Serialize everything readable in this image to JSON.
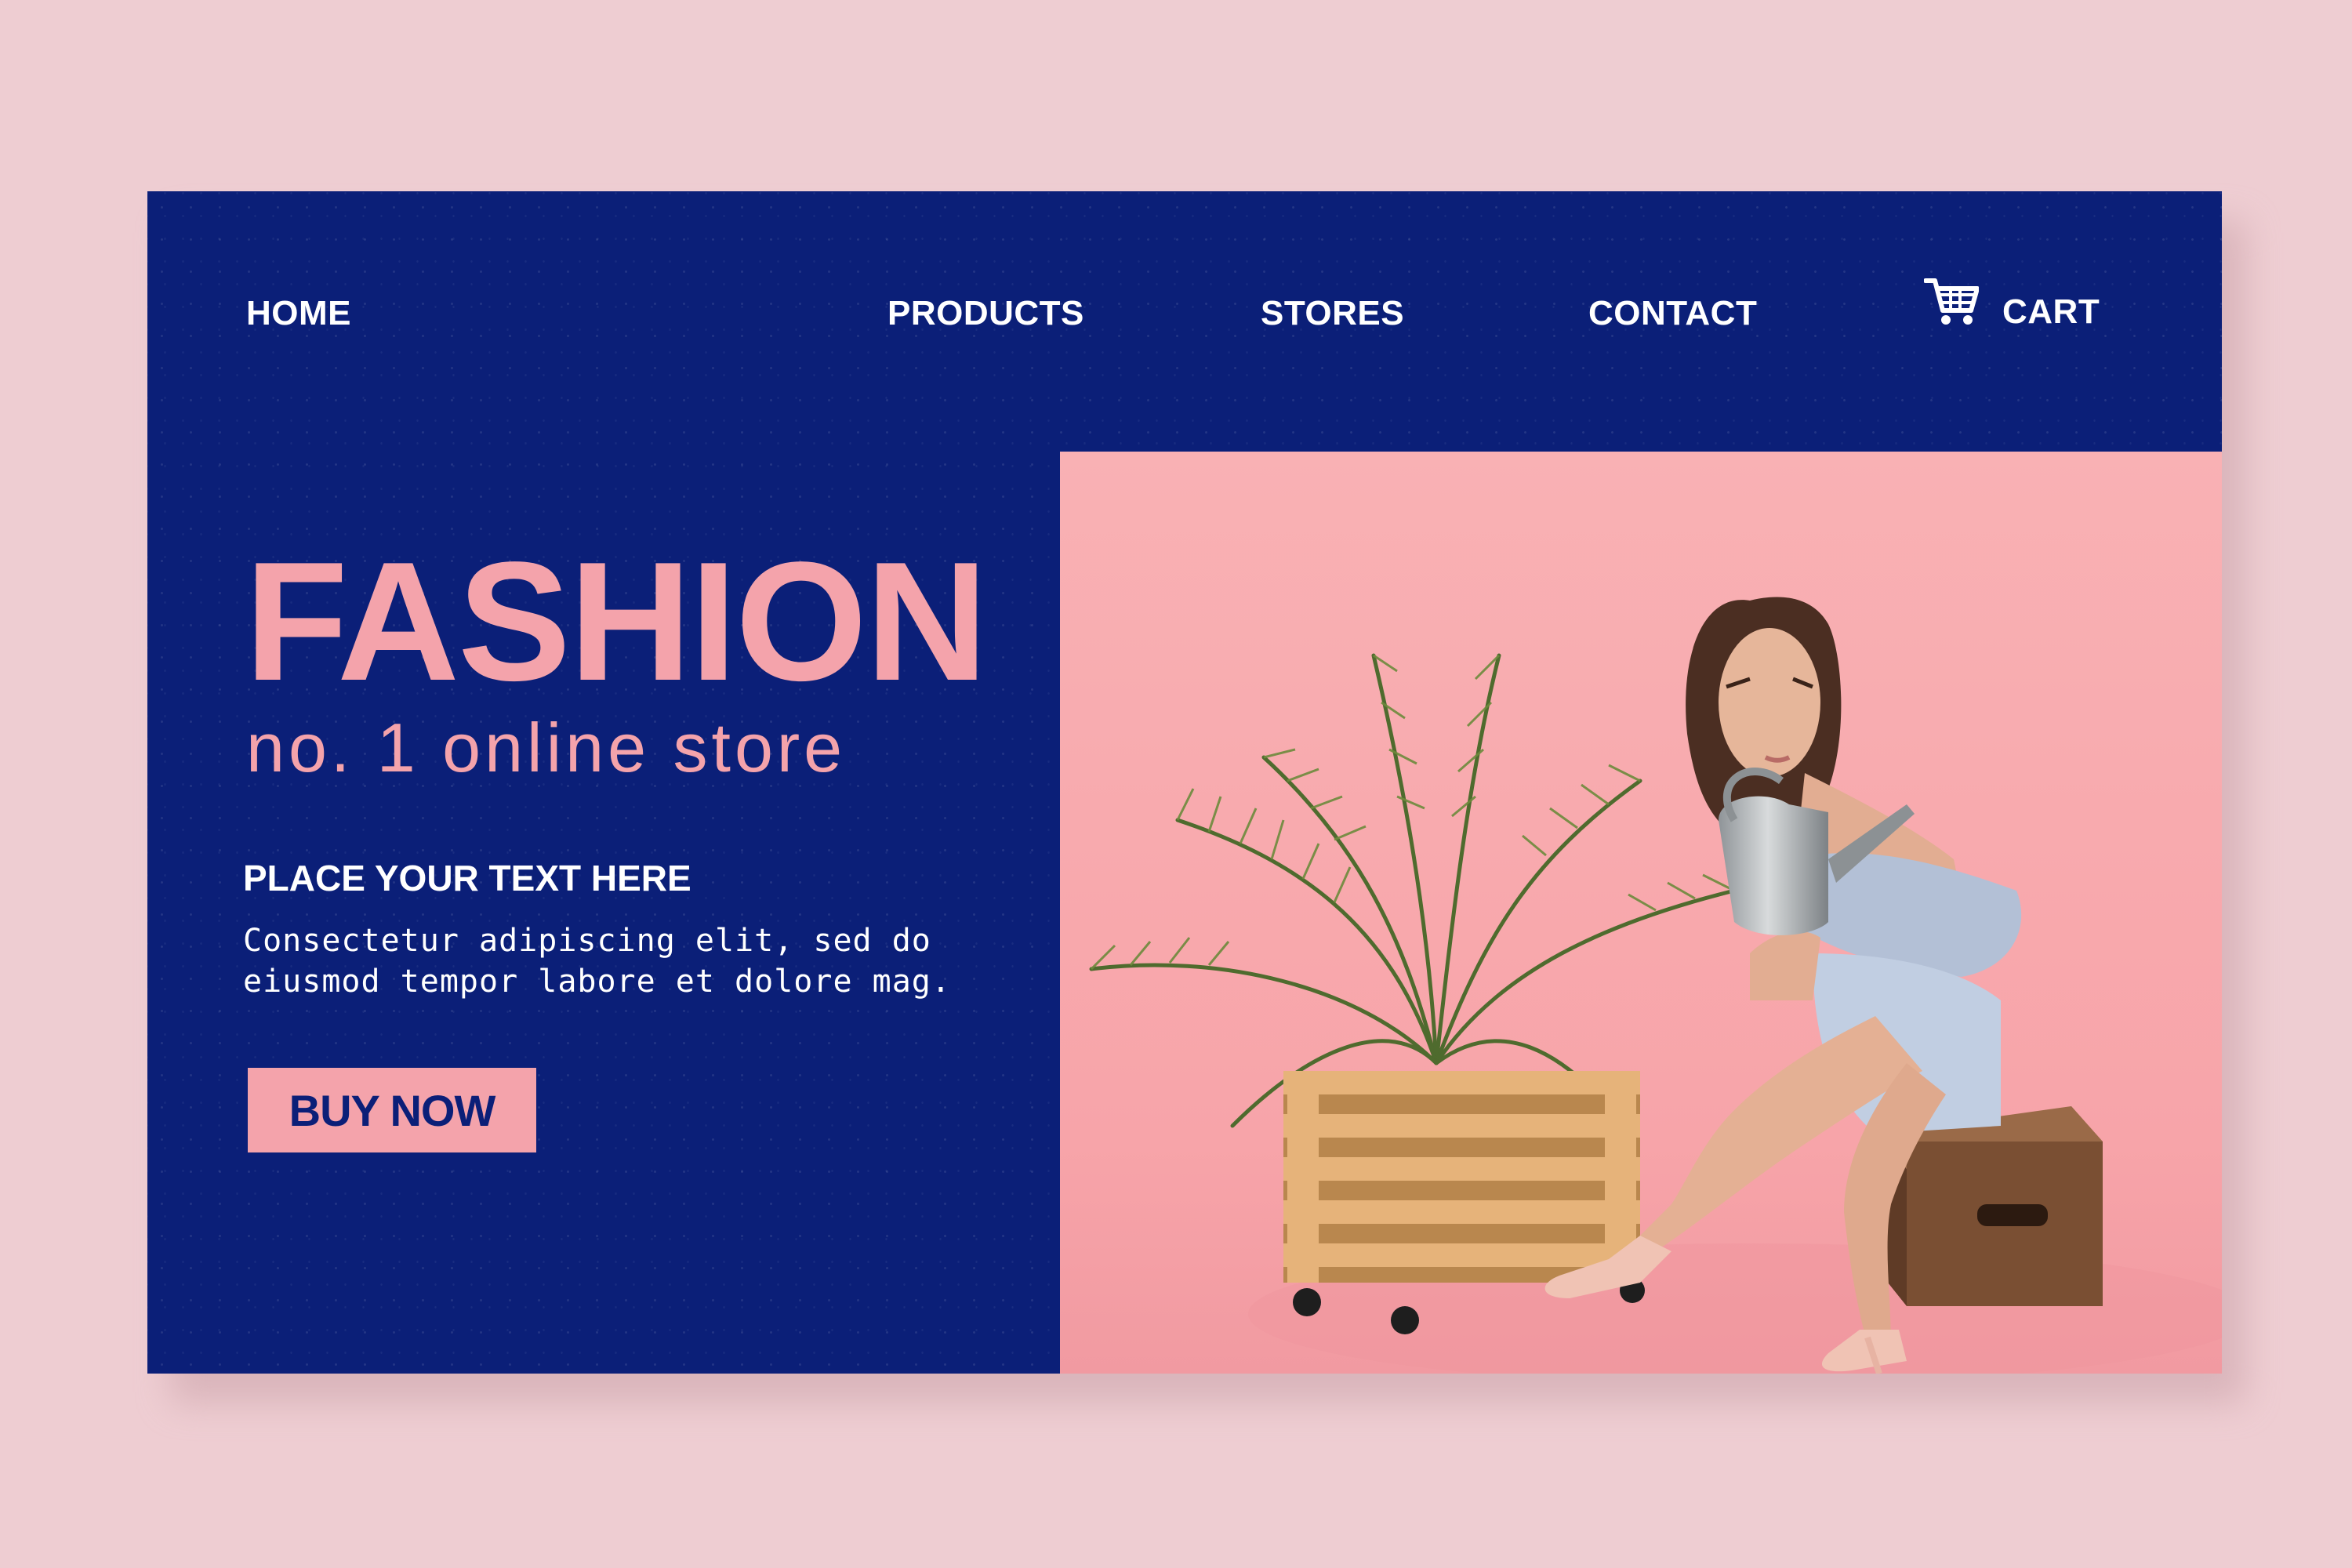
{
  "nav": {
    "home": "HOME",
    "products": "PRODUCTS",
    "stores": "STORES",
    "contact": "CONTACT",
    "cart": "CART",
    "cart_icon": "cart-icon"
  },
  "hero": {
    "title": "FASHION",
    "subtitle": "no. 1 online store",
    "heading": "PLACE YOUR TEXT HERE",
    "body_line1": "Consectetur adipiscing elit, sed do",
    "body_line2": "eiusmod tempor labore et dolore mag.",
    "cta": "BUY NOW"
  },
  "colors": {
    "page_background": "#eecdd2",
    "panel": "#0b1f78",
    "accent_pink": "#f4a3ab",
    "photo_background": "#f8a9ad"
  }
}
